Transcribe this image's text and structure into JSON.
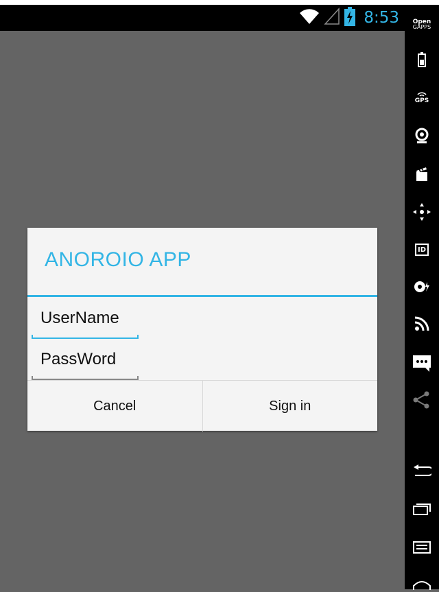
{
  "status_bar": {
    "time": "8:53",
    "icons": [
      "wifi-icon",
      "cell-signal-icon",
      "battery-charging-icon"
    ]
  },
  "sidebar": {
    "open_gapps_line1": "Open",
    "open_gapps_line2": "GAPPS",
    "gps_label": "GPS",
    "id_label": "ID",
    "items": [
      "battery-icon",
      "gps-icon",
      "camera-icon",
      "media-icon",
      "dpad-icon",
      "id-icon",
      "remote-control-icon",
      "cast-icon",
      "sms-icon",
      "share-icon",
      "back-icon",
      "recent-apps-icon",
      "menu-icon",
      "home-icon"
    ]
  },
  "dialog": {
    "title": "ANOROIO  APP",
    "username_value": "UserName",
    "password_value": "PassWord",
    "cancel_label": "Cancel",
    "signin_label": "Sign in"
  },
  "colors": {
    "accent": "#33b5e5",
    "dim_background": "#646464",
    "dialog_background": "#f4f4f4"
  }
}
